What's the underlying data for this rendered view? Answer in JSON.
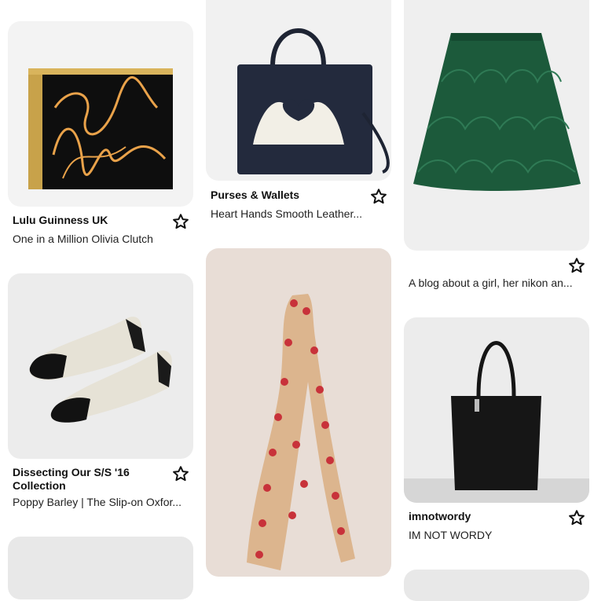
{
  "colors": {
    "placeholder": "#efefef",
    "text": "#111111"
  },
  "icons": {
    "save": "star-outline-icon"
  },
  "pins": [
    {
      "title": "Lulu Guinness UK",
      "description": "One in a Million Olivia Clutch"
    },
    {
      "title": "Purses & Wallets",
      "description": "Heart Hands Smooth Leather..."
    },
    {
      "title": "",
      "description": "A blog about a girl, her nikon an..."
    },
    {
      "title": "Dissecting Our S/S '16 Collection",
      "description": "Poppy Barley | The Slip-on Oxfor..."
    },
    {
      "title": "",
      "description": ""
    },
    {
      "title": "imnotwordy",
      "description": "IM NOT WORDY"
    }
  ]
}
